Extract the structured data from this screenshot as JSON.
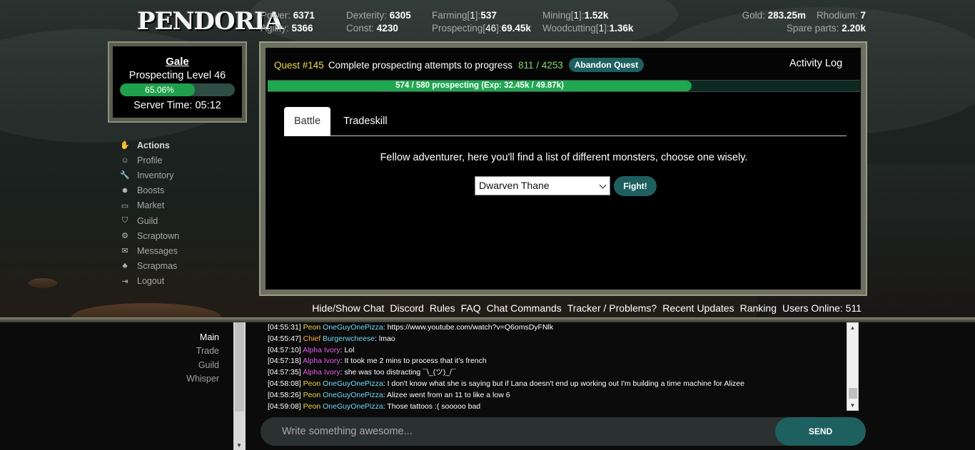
{
  "app": {
    "logo_text": "PENDORIA"
  },
  "stats": {
    "power": {
      "label": "Power:",
      "value": "6371"
    },
    "agility": {
      "label": "Agility:",
      "value": "5366"
    },
    "dexterity": {
      "label": "Dexterity:",
      "value": "6305"
    },
    "const": {
      "label": "Const:",
      "value": "4230"
    },
    "farming": {
      "label": "Farming",
      "level": "1",
      "value": "537"
    },
    "prospecting": {
      "label": "Prospecting",
      "level": "46",
      "value": "69.45k"
    },
    "mining": {
      "label": "Mining",
      "level": "1",
      "value": "1.52k"
    },
    "woodcutting": {
      "label": "Woodcutting",
      "level": "1",
      "value": "1.36k"
    },
    "gold": {
      "label": "Gold:",
      "value": "283.25m"
    },
    "rhodium": {
      "label": "Rhodium:",
      "value": "7"
    },
    "spare_parts": {
      "label": "Spare parts:",
      "value": "2.20k"
    }
  },
  "player": {
    "name": "Gale",
    "level_text": "Prospecting Level 46",
    "progress_text": "65.06%",
    "progress_fraction": 0.6506,
    "server_time": "Server Time: 05:12"
  },
  "nav": {
    "items": [
      {
        "label": "Actions",
        "icon": "hand-icon",
        "glyph": "✋"
      },
      {
        "label": "Profile",
        "icon": "user-icon",
        "glyph": "☺"
      },
      {
        "label": "Inventory",
        "icon": "wrench-icon",
        "glyph": "🔧"
      },
      {
        "label": "Boosts",
        "icon": "gear-icon",
        "glyph": "✹"
      },
      {
        "label": "Market",
        "icon": "basket-icon",
        "glyph": "▭"
      },
      {
        "label": "Guild",
        "icon": "shield-icon",
        "glyph": "⛉"
      },
      {
        "label": "Scraptown",
        "icon": "cog-icon",
        "glyph": "⚙"
      },
      {
        "label": "Messages",
        "icon": "envelope-icon",
        "glyph": "✉"
      },
      {
        "label": "Scrapmas",
        "icon": "tree-icon",
        "glyph": "♣"
      },
      {
        "label": "Logout",
        "icon": "logout-icon",
        "glyph": "⇥"
      }
    ]
  },
  "quest": {
    "number": "Quest #145",
    "description": "Complete prospecting attempts to progress",
    "progress": "811 / 4253",
    "abandon_label": "Abandon Quest",
    "activity_log_label": "Activity Log"
  },
  "action_bar": {
    "text": "574 / 580 prospecting (Exp: 32.45k / 49.87k)",
    "fraction": 0.9897
  },
  "tabs": [
    {
      "label": "Battle"
    },
    {
      "label": "Tradeskill"
    }
  ],
  "battle": {
    "intro": "Fellow adventurer, here you'll find a list of different monsters, choose one wisely.",
    "selected_monster": "Dwarven Thane",
    "fight_label": "Fight!"
  },
  "links": [
    "Hide/Show Chat",
    "Discord",
    "Rules",
    "FAQ",
    "Chat Commands",
    "Tracker / Problems?",
    "Recent Updates",
    "Ranking",
    "Users Online: 511"
  ],
  "chat": {
    "tabs": [
      "Main",
      "Trade",
      "Guild",
      "Whisper"
    ],
    "messages": [
      {
        "time": "[04:55:31]",
        "rank": "Peon",
        "user": "OneGuyOnePizza",
        "user_color": "cyan",
        "text": ": https://www.youtube.com/watch?v=Q6omsDyFNlk"
      },
      {
        "time": "[04:55:47]",
        "rank": "Chief",
        "user": "Burgerwcheese",
        "user_color": "cyan",
        "text": ": lmao"
      },
      {
        "time": "[04:57:10]",
        "rank": "Alpha",
        "user": "Ivory",
        "user_color": "purple",
        "text": ": Lol"
      },
      {
        "time": "[04:57:18]",
        "rank": "Alpha",
        "user": "Ivory",
        "user_color": "purple",
        "text": ": It took me 2 mins to process that it's french"
      },
      {
        "time": "[04:57:35]",
        "rank": "Alpha",
        "user": "Ivory",
        "user_color": "purple",
        "text": ": she was too distracting ¯\\_(ツ)_/¯"
      },
      {
        "time": "[04:58:08]",
        "rank": "Peon",
        "user": "OneGuyOnePizza",
        "user_color": "cyan",
        "text": ": I don't know what she is saying but if Lana doesn't end up working out I'm building a time machine for Alizee"
      },
      {
        "time": "[04:58:26]",
        "rank": "Peon",
        "user": "OneGuyOnePizza",
        "user_color": "cyan",
        "text": ": Alizee went from an 11 to like a low 6"
      },
      {
        "time": "[04:59:08]",
        "rank": "Peon",
        "user": "OneGuyOnePizza",
        "user_color": "cyan",
        "text": ": Those tattoos :( sooooo bad"
      }
    ],
    "input_placeholder": "Write something awesome...",
    "send_label": "SEND"
  }
}
